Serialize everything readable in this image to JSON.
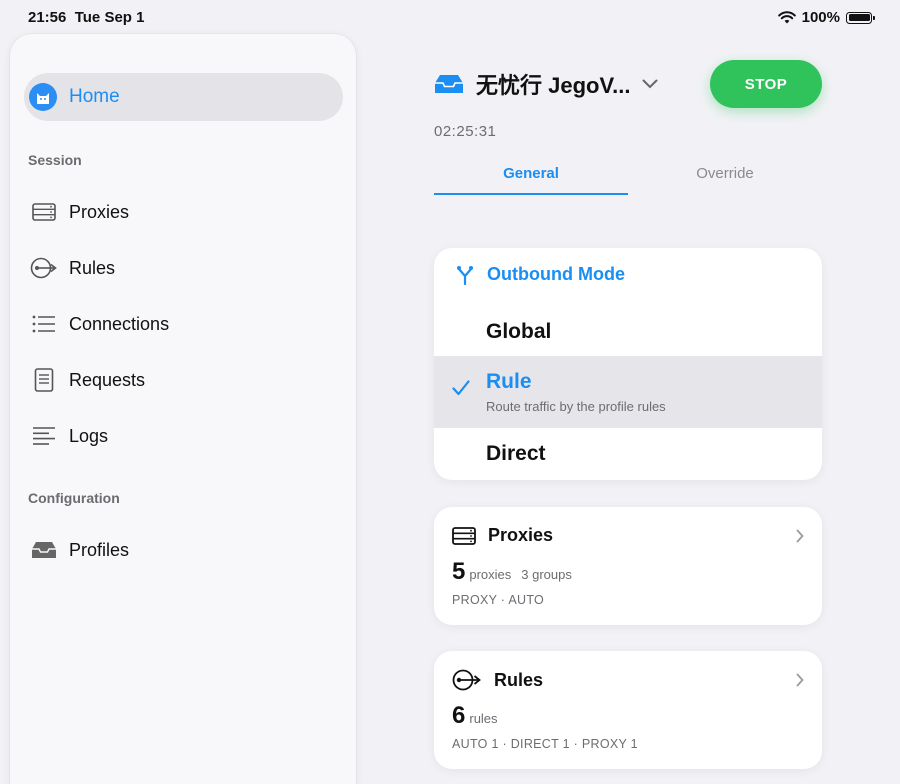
{
  "status_bar": {
    "time": "21:56",
    "date": "Tue Sep 1",
    "battery": "100%"
  },
  "sidebar": {
    "home": {
      "label": "Home"
    },
    "sections": [
      {
        "title": "Session",
        "items": [
          "Proxies",
          "Rules",
          "Connections",
          "Requests",
          "Logs"
        ]
      },
      {
        "title": "Configuration",
        "items": [
          "Profiles"
        ]
      }
    ]
  },
  "header": {
    "profile_name": "无忧行 JegoV...",
    "stop_label": "STOP",
    "timer": "02:25:31"
  },
  "tabs": [
    {
      "label": "General",
      "active": true
    },
    {
      "label": "Override",
      "active": false
    }
  ],
  "outbound_mode": {
    "title": "Outbound Mode",
    "options": [
      {
        "name": "Global",
        "selected": false
      },
      {
        "name": "Rule",
        "selected": true,
        "description": "Route traffic by the profile rules"
      },
      {
        "name": "Direct",
        "selected": false
      }
    ]
  },
  "proxies_card": {
    "title": "Proxies",
    "count": "5",
    "count_unit": "proxies",
    "groups": "3 groups",
    "footer": "PROXY · AUTO"
  },
  "rules_card": {
    "title": "Rules",
    "count": "6",
    "count_unit": "rules",
    "footer": "AUTO 1 · DIRECT 1 · PROXY 1"
  },
  "colors": {
    "accent": "#1a8ef2",
    "stop": "#30c35c",
    "background": "#f2f2f6"
  }
}
